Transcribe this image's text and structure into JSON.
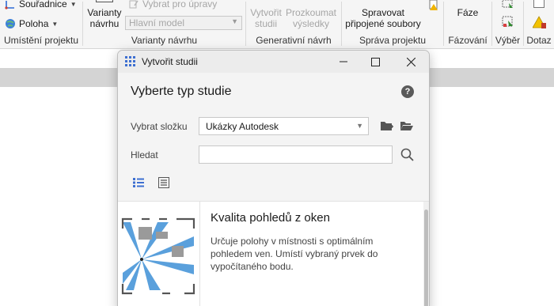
{
  "ribbon": {
    "groups": {
      "location": {
        "title": "Umístění projektu",
        "coordinates_label": "Souřadnice",
        "position_label": "Poloha"
      },
      "variants": {
        "title": "Varianty návrhu",
        "variants_label_line1": "Varianty",
        "variants_label_line2": "návrhu",
        "select_for_edit_label": "Vybrat pro úpravy",
        "model_combo_value": "Hlavní model"
      },
      "generative": {
        "title": "Generativní návrh",
        "create_study_line1": "Vytvořit",
        "create_study_line2": "studii",
        "explore_results_line1": "Prozkoumat",
        "explore_results_line2": "výsledky"
      },
      "project": {
        "title": "Správa projektu",
        "manage_links_line1": "Spravovat",
        "manage_links_line2": "připojené soubory"
      },
      "phasing": {
        "title": "Fázování",
        "phases_label": "Fáze"
      },
      "selection": {
        "title": "Výběr"
      },
      "inquiry": {
        "title": "Dotaz"
      }
    }
  },
  "dialog": {
    "title": "Vytvořit studii",
    "heading": "Vyberte typ studie",
    "folder_label": "Vybrat složku",
    "folder_value": "Ukázky Autodesk",
    "search_label": "Hledat",
    "search_value": "",
    "card": {
      "title": "Kvalita pohledů z oken",
      "description": "Určuje polohy v místnosti s optimálním pohledem ven. Umístí vybraný prvek do vypočítaného bodu."
    }
  },
  "colors": {
    "accent": "#3d6fd1",
    "thumb_ray": "#5aa0dc",
    "thumb_block": "#9a9a9a"
  }
}
